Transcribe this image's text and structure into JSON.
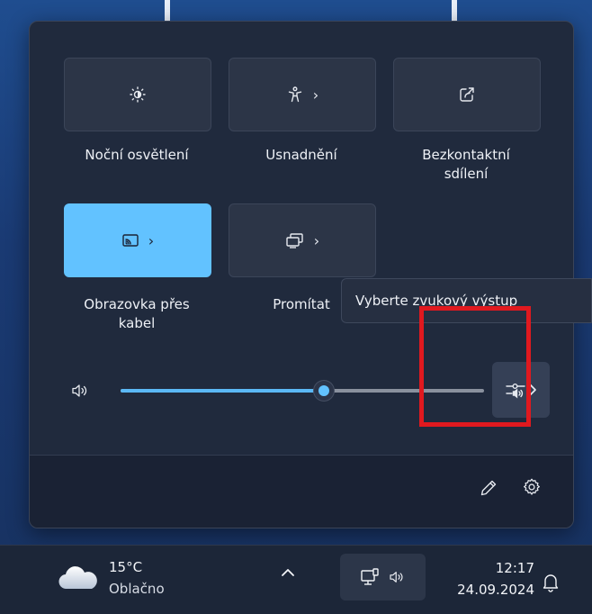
{
  "quick_settings": {
    "tiles": [
      {
        "label": "Noční osvětlení",
        "icon": "brightness-icon",
        "active": false,
        "has_chevron": false
      },
      {
        "label": "Usnadnění",
        "icon": "accessibility-icon",
        "active": false,
        "has_chevron": true
      },
      {
        "label": "Bezkontaktní\nsdílení",
        "icon": "share-icon",
        "active": false,
        "has_chevron": false
      },
      {
        "label": "Obrazovka přes\nkabel",
        "icon": "cast-icon",
        "active": true,
        "has_chevron": true
      },
      {
        "label": "Promítat",
        "icon": "project-icon",
        "active": false,
        "has_chevron": true
      }
    ],
    "tile_chevron": "›",
    "volume": {
      "level": 0.56
    },
    "tooltip": "Vyberte zvukový výstup",
    "accent_color": "#62c2ff"
  },
  "taskbar": {
    "weather": {
      "temperature": "15°C",
      "condition": "Oblačno"
    },
    "clock": {
      "time": "12:17",
      "date": "24.09.2024"
    }
  }
}
